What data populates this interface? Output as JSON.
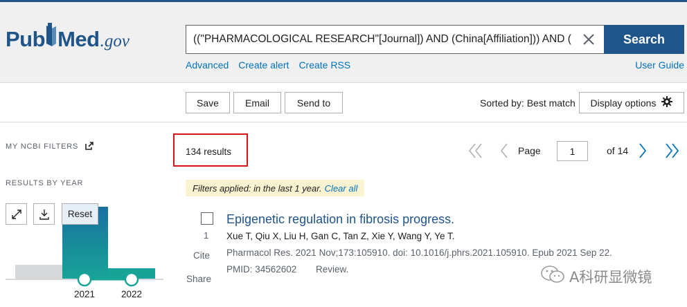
{
  "header": {
    "logo": {
      "pub": "Pub",
      "med": "Med",
      "gov": ".gov"
    },
    "search": {
      "query": "((\"PHARMACOLOGICAL RESEARCH\"[Journal]) AND (China[Affiliation])) AND (",
      "button_label": "Search"
    },
    "links": {
      "advanced": "Advanced",
      "create_alert": "Create alert",
      "create_rss": "Create RSS",
      "user_guide": "User Guide"
    }
  },
  "toolbar": {
    "save": "Save",
    "email": "Email",
    "send_to": "Send to",
    "sorted_by": "Sorted by: Best match",
    "display_options": "Display options"
  },
  "sidebar": {
    "my_ncbi_filters": "MY NCBI FILTERS",
    "results_by_year": "RESULTS BY YEAR",
    "reset": "Reset",
    "years": [
      "2021",
      "2022"
    ]
  },
  "results": {
    "count": "134 results",
    "filters_applied": "Filters applied: in the last 1 year.",
    "clear_all": "Clear all",
    "pagination": {
      "page_label": "Page",
      "current_page": "1",
      "of_label": "of 14"
    },
    "items": [
      {
        "number": "1",
        "title": "Epigenetic regulation in fibrosis progress.",
        "authors": "Xue T, Qiu X, Liu H, Gan C, Tan Z, Xie Y, Wang Y, Ye T.",
        "journal": "Pharmacol Res. 2021 Nov;173:105910. doi: 10.1016/j.phrs.2021.105910. Epub 2021 Sep 22.",
        "pmid": "PMID: 34562602",
        "type": "Review.",
        "cite_label": "Cite",
        "share_label": "Share"
      }
    ]
  },
  "watermark": {
    "text": "A科研显微镜"
  },
  "colors": {
    "brand": "#20558a",
    "link": "#0071bc",
    "highlight_box": "#d7141a",
    "chart_teal": "#17a497",
    "filter_bg": "#faf3d1"
  }
}
